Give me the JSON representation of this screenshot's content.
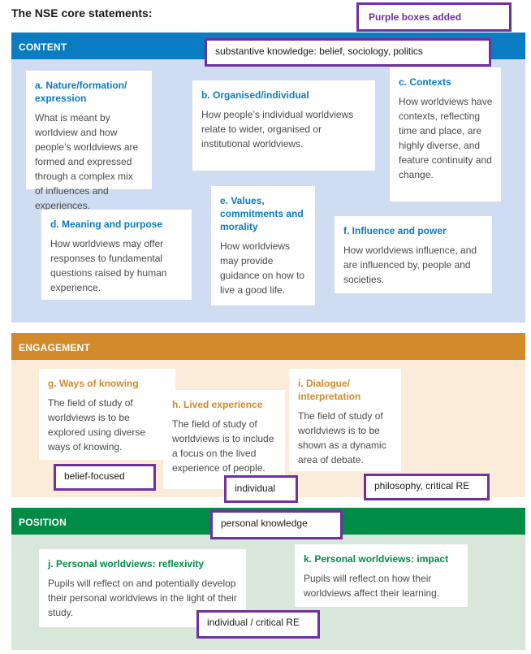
{
  "title": "The NSE core statements:",
  "legend_note": "Purple boxes added",
  "colors": {
    "content": "#0a7cc1",
    "engagement": "#d38a2a",
    "position": "#008c47",
    "annotation": "#7030a0"
  },
  "sections": {
    "content": {
      "label": "CONTENT",
      "annotation": "substantive knowledge:  belief, sociology, politics",
      "cards": [
        {
          "title": "a. Nature/formation/ expression",
          "body": "What is meant by worldview and how people’s worldviews are formed and expressed through a complex mix of influences and experiences."
        },
        {
          "title": "b. Organised/individual",
          "body": "How people’s individual worldviews relate to wider, organised or institutional worldviews."
        },
        {
          "title": "c. Contexts",
          "body": "How worldviews have contexts, reflecting time and place, are highly diverse, and feature continuity and change."
        },
        {
          "title": "d. Meaning and purpose",
          "body": "How worldviews may offer responses to fundamental questions raised by human experience."
        },
        {
          "title": "e. Values, commitments and morality",
          "body": "How worldviews may provide guidance on how to live a good life."
        },
        {
          "title": "f. Influence and power",
          "body": "How worldviews influence, and are influenced by, people and societies."
        }
      ]
    },
    "engagement": {
      "label": "ENGAGEMENT",
      "cards": [
        {
          "title": "g. Ways of knowing",
          "body": "The field of study of worldviews is to be explored using diverse ways of knowing.",
          "annotation": "belief-focused"
        },
        {
          "title": "h. Lived experience",
          "body": "The field of study of worldviews is to include a focus on the lived experience of people.",
          "annotation": "individual"
        },
        {
          "title": "i. Dialogue/ interpretation",
          "body": "The field of study of worldviews is to be shown as a dynamic area of debate.",
          "annotation": "philosophy, critical RE"
        }
      ]
    },
    "position": {
      "label": "POSITION",
      "annotation": "personal knowledge",
      "cards": [
        {
          "title": "j. Personal worldviews: reflexivity",
          "body": "Pupils will reflect on and potentially develop their personal worldviews in the light of their study.",
          "annotation": "individual / critical RE"
        },
        {
          "title": "k. Personal worldviews: impact",
          "body": "Pupils will reflect on how their worldviews affect their learning."
        }
      ]
    }
  }
}
